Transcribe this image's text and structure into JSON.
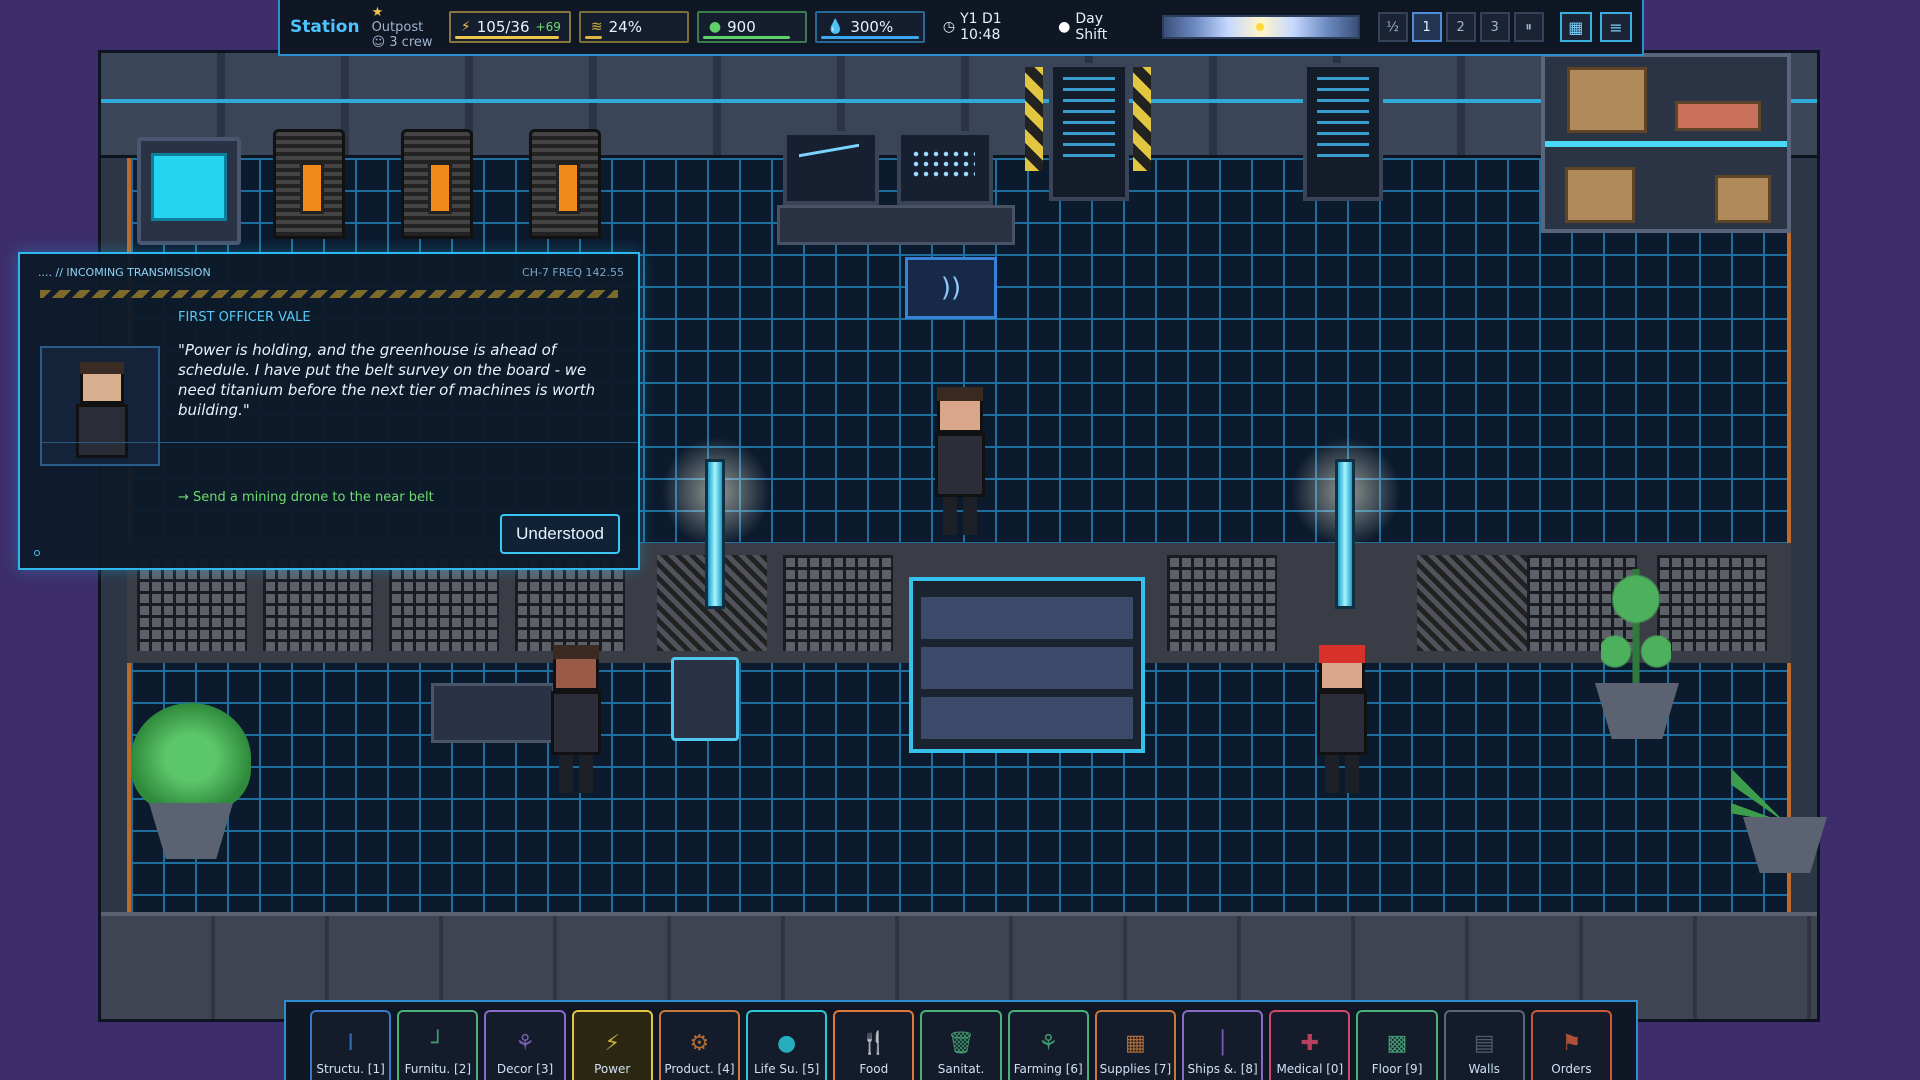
{
  "hud": {
    "station_label": "Station",
    "tier_label": "Outpost",
    "crew_label": "3 crew",
    "resources": [
      {
        "id": "power",
        "icon": "power-bolt-icon",
        "glyph": "⚡",
        "value": "105/36",
        "delta": "+69",
        "color": "#f0c34a",
        "fill": 0.95
      },
      {
        "id": "oxygen",
        "icon": "oxygen-icon",
        "glyph": "≋",
        "value": "24%",
        "delta": "",
        "color": "#d8b640",
        "fill": 0.24
      },
      {
        "id": "food",
        "icon": "food-apple-icon",
        "glyph": "●",
        "value": "900",
        "delta": "",
        "color": "#5fd06a",
        "fill": 0.9
      },
      {
        "id": "water",
        "icon": "water-drop-icon",
        "glyph": "💧",
        "value": "300%",
        "delta": "",
        "color": "#3aa8f0",
        "fill": 1.0
      }
    ],
    "clock": "Y1 D1  10:48",
    "shift": "Day Shift",
    "speeds": [
      {
        "label": "½",
        "active": false
      },
      {
        "label": "1",
        "active": true
      },
      {
        "label": "2",
        "active": false
      },
      {
        "label": "3",
        "active": false
      },
      {
        "label": "⏸",
        "active": false
      }
    ]
  },
  "dialog": {
    "title": ".... // INCOMING TRANSMISSION",
    "channel": "CH-7  FREQ 142.55",
    "speaker": "FIRST OFFICER VALE",
    "quote": "\"Power is holding, and the greenhouse is ahead of schedule. I have put the belt survey on the board - we need titanium before the next tier of machines is worth building.\"",
    "objective": "→  Send a mining drone to the near belt",
    "ack_label": "Understood"
  },
  "buildbar": [
    {
      "label": "Structu. [1]",
      "icon": "structure-icon",
      "glyph": "I",
      "color": "#3a78c8",
      "active": false
    },
    {
      "label": "Furnitu. [2]",
      "icon": "furniture-icon",
      "glyph": "┘",
      "color": "#4ab07a",
      "active": false
    },
    {
      "label": "Decor [3]",
      "icon": "decor-icon",
      "glyph": "⚘",
      "color": "#8a6ac8",
      "active": false
    },
    {
      "label": "Power",
      "icon": "power-icon",
      "glyph": "⚡",
      "color": "#e2c640",
      "active": true
    },
    {
      "label": "Product. [4]",
      "icon": "production-gear-icon",
      "glyph": "⚙",
      "color": "#c8783a",
      "active": false
    },
    {
      "label": "Life Su. [5]",
      "icon": "life-support-drop-icon",
      "glyph": "●",
      "color": "#2ac8d8",
      "active": false
    },
    {
      "label": "Food",
      "icon": "food-utensils-icon",
      "glyph": "🍴",
      "color": "#e0783a",
      "active": false
    },
    {
      "label": "Sanitat.",
      "icon": "sanitation-bin-icon",
      "glyph": "🗑",
      "color": "#4ab07a",
      "active": false
    },
    {
      "label": "Farming [6]",
      "icon": "farming-sprout-icon",
      "glyph": "⚘",
      "color": "#4ab07a",
      "active": false
    },
    {
      "label": "Supplies [7]",
      "icon": "supplies-box-icon",
      "glyph": "▦",
      "color": "#c8783a",
      "active": false
    },
    {
      "label": "Ships &. [8]",
      "icon": "ships-icon",
      "glyph": "│",
      "color": "#8a6ac8",
      "active": false
    },
    {
      "label": "Medical [0]",
      "icon": "medical-cross-icon",
      "glyph": "✚",
      "color": "#d0486a",
      "active": false
    },
    {
      "label": "Floor [9]",
      "icon": "floor-tile-icon",
      "glyph": "▩",
      "color": "#4ab07a",
      "active": false
    },
    {
      "label": "Walls",
      "icon": "walls-icon",
      "glyph": "▤",
      "color": "#5a6678",
      "active": false
    },
    {
      "label": "Orders",
      "icon": "orders-icon",
      "glyph": "⚑",
      "color": "#c85a3a",
      "active": false
    }
  ]
}
